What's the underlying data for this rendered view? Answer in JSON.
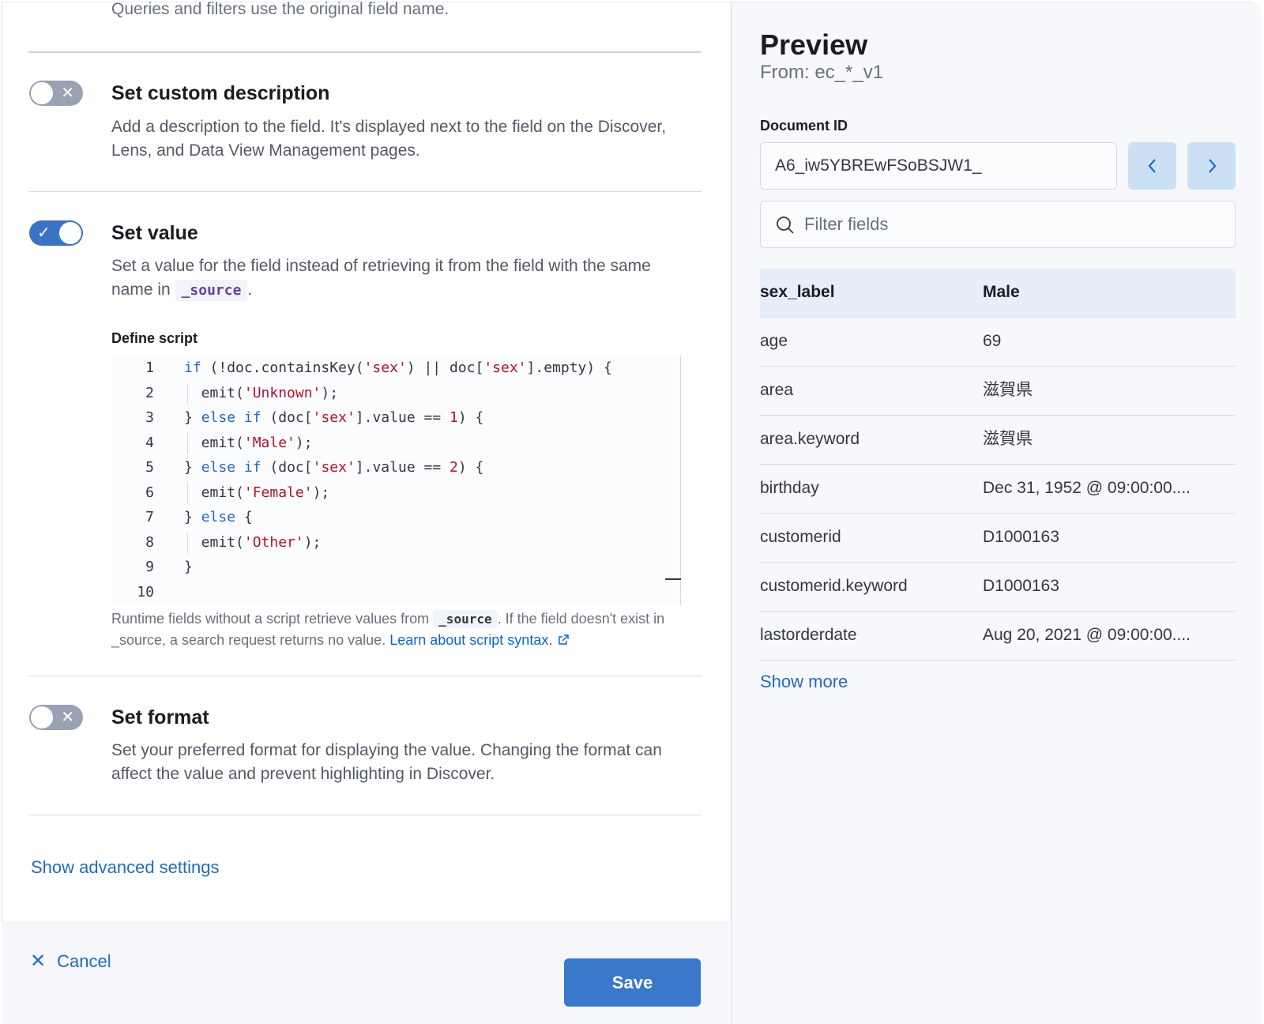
{
  "editor_panel": {
    "intro_text": "Queries and filters use the original field name.",
    "custom_description": {
      "title": "Set custom description",
      "description": "Add a description to the field. It's displayed next to the field on the Discover, Lens, and Data View Management pages.",
      "enabled": false
    },
    "set_value": {
      "title": "Set value",
      "description_before": "Set a value for the field instead of retrieving it from the field with the same name in",
      "description_code": "_source",
      "description_after": ".",
      "enabled": true,
      "script_label": "Define script",
      "script_lines": [
        "if (!doc.containsKey('sex') || doc['sex'].empty) {",
        "  emit('Unknown');",
        "} else if (doc['sex'].value == 1) {",
        "  emit('Male');",
        "} else if (doc['sex'].value == 2) {",
        "  emit('Female');",
        "} else {",
        "  emit('Other');",
        "}",
        ""
      ],
      "help_before": "Runtime fields without a script retrieve values from",
      "help_code": "_source",
      "help_after": ". If the field doesn't exist in _source, a search request returns no value.",
      "help_link": "Learn about script syntax."
    },
    "set_format": {
      "title": "Set format",
      "description": "Set your preferred format for displaying the value. Changing the format can affect the value and prevent highlighting in Discover.",
      "enabled": false
    },
    "advanced_link": "Show advanced settings",
    "cancel_label": "Cancel",
    "save_label": "Save"
  },
  "preview": {
    "title": "Preview",
    "from": "From: ec_*_v1",
    "doc_id_label": "Document ID",
    "doc_id_value": "A6_iw5YBREwFSoBSJW1_",
    "filter_placeholder": "Filter fields",
    "fields": [
      {
        "name": "sex_label",
        "value": "Male",
        "highlight": true
      },
      {
        "name": "age",
        "value": "69"
      },
      {
        "name": "area",
        "value": "滋賀県"
      },
      {
        "name": "area.keyword",
        "value": "滋賀県"
      },
      {
        "name": "birthday",
        "value": "Dec 31, 1952 @ 09:00:00...."
      },
      {
        "name": "customerid",
        "value": "D1000163"
      },
      {
        "name": "customerid.keyword",
        "value": "D1000163"
      },
      {
        "name": "lastorderdate",
        "value": "Aug 20, 2021 @ 09:00:00...."
      }
    ],
    "show_more": "Show more"
  },
  "colors": {
    "primary": "#3a78c9",
    "link": "#1f6bc1",
    "toggle_on": "#3a72c6",
    "toggle_off": "#98a2b3",
    "highlight_row": "#e6eef9"
  }
}
